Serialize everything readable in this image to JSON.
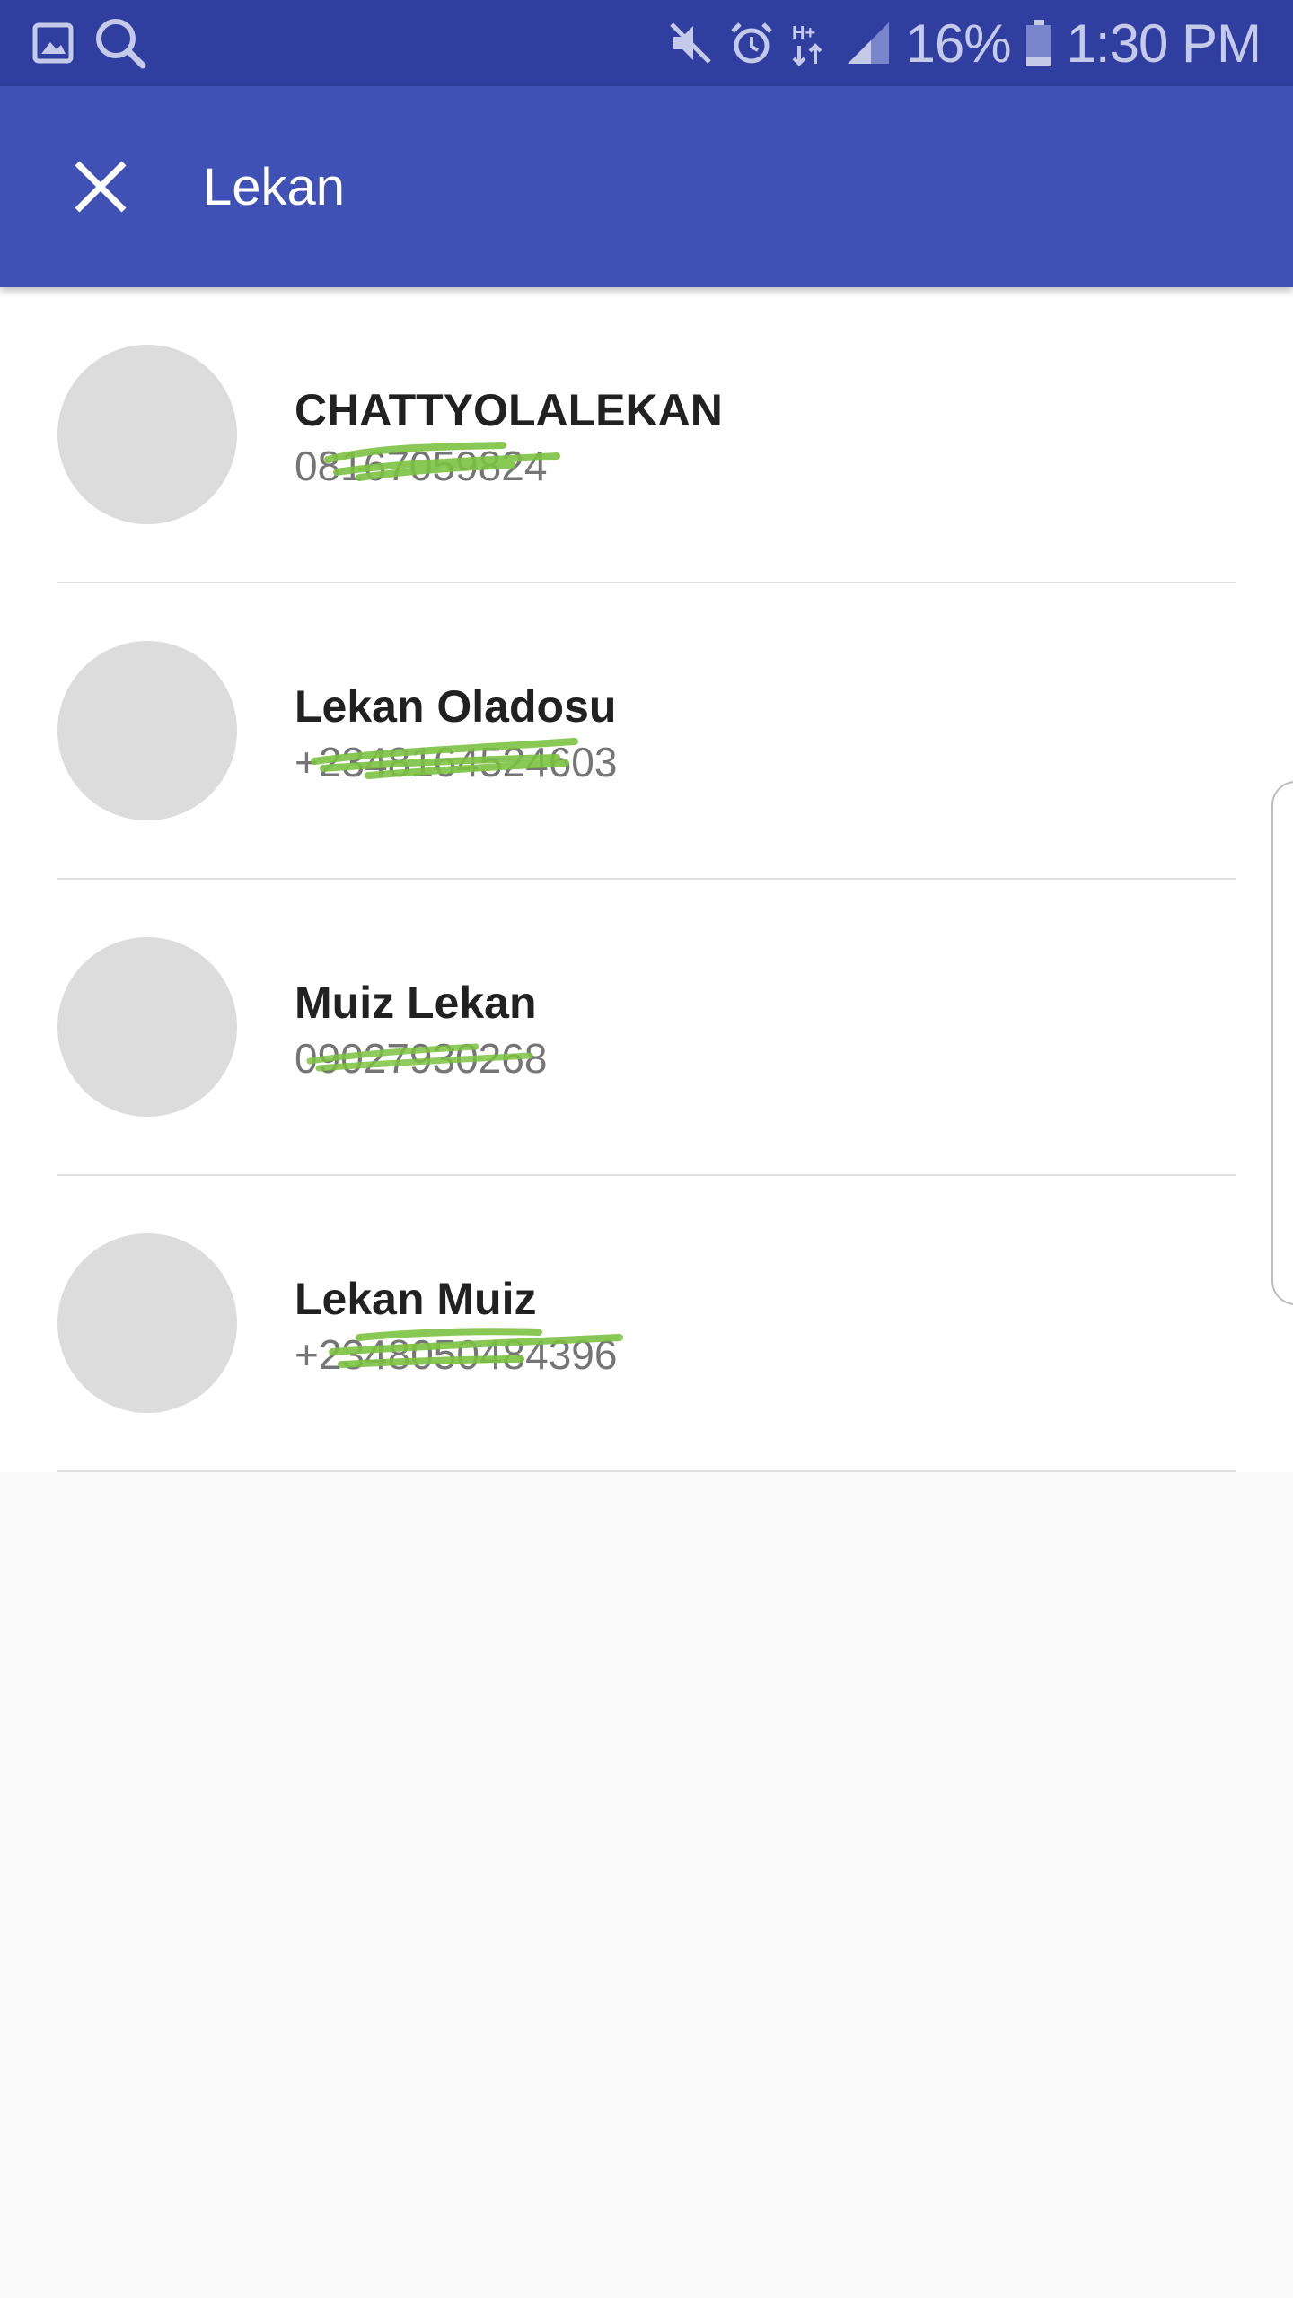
{
  "status_bar": {
    "left_icons": [
      "gallery-icon",
      "search-icon"
    ],
    "right_icons": [
      "mute-icon",
      "alarm-icon",
      "hplus-data-icon",
      "signal-icon"
    ],
    "battery_percent": "16%",
    "time": "1:30 PM"
  },
  "toolbar": {
    "close_icon": "close-icon",
    "search_value": "Lekan",
    "color": "#3f51b5",
    "status_color": "#303f9f"
  },
  "contacts": [
    {
      "name": "CHATTYOLALEKAN",
      "phone": "08167059824"
    },
    {
      "name": "Lekan Oladosu",
      "phone": "+2348164524603"
    },
    {
      "name": "Muiz Lekan",
      "phone": "09027930268"
    },
    {
      "name": "Lekan Muiz",
      "phone": "+2348050484396"
    }
  ],
  "redaction_color": "#7cc242"
}
